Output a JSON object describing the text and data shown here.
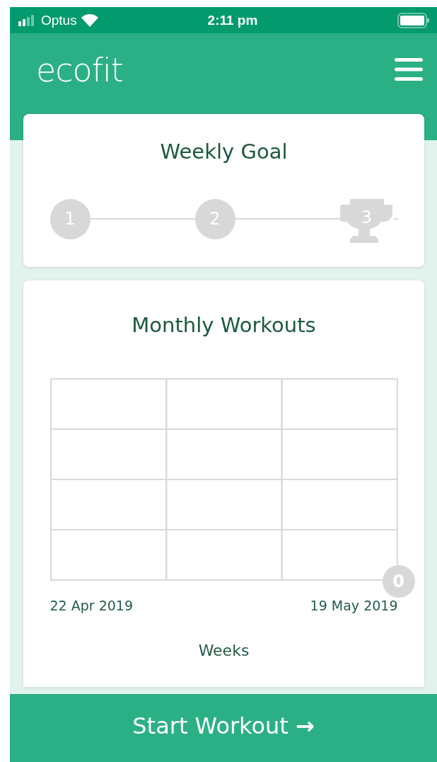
{
  "status_bar": {
    "carrier": "Optus",
    "time": "2:11 pm"
  },
  "header": {
    "logo": "ecofit"
  },
  "weekly_goal": {
    "title": "Weekly Goal",
    "steps": [
      {
        "label": "1",
        "kind": "circle",
        "done": false
      },
      {
        "label": "2",
        "kind": "circle",
        "done": false
      },
      {
        "label": "3",
        "kind": "trophy",
        "done": false
      }
    ]
  },
  "monthly_workouts": {
    "title": "Monthly Workouts",
    "value_badge": "0",
    "start_label": "22 Apr 2019",
    "end_label": "19 May 2019",
    "xlabel": "Weeks"
  },
  "start_button": {
    "label": "Start Workout",
    "arrow": "→"
  }
}
